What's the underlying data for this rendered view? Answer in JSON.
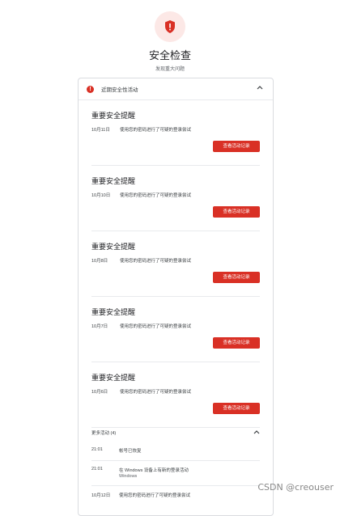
{
  "header": {
    "title": "安全检查",
    "subtitle": "发现重大问题"
  },
  "card": {
    "section_label": "近期安全性活动",
    "alerts": [
      {
        "title": "重要安全提醒",
        "date": "10月11日",
        "description": "使用您的密码进行了可疑的登录尝试",
        "button": "查看活动记录"
      },
      {
        "title": "重要安全提醒",
        "date": "10月10日",
        "description": "使用您的密码进行了可疑的登录尝试",
        "button": "查看活动记录"
      },
      {
        "title": "重要安全提醒",
        "date": "10月8日",
        "description": "使用您的密码进行了可疑的登录尝试",
        "button": "查看活动记录"
      },
      {
        "title": "重要安全提醒",
        "date": "10月7日",
        "description": "使用您的密码进行了可疑的登录尝试",
        "button": "查看活动记录"
      },
      {
        "title": "重要安全提醒",
        "date": "10月6日",
        "description": "使用您的密码进行了可疑的登录尝试",
        "button": "查看活动记录"
      }
    ],
    "more": {
      "label": "更多活动 (4)",
      "items": [
        {
          "time": "21:01",
          "description": "帐号已恢复",
          "sub": ""
        },
        {
          "time": "21:01",
          "description": "在 Windows 设备上有新的登录活动",
          "sub": "Windows"
        },
        {
          "time": "10月12日",
          "description": "使用您的密码进行了可疑的登录尝试",
          "sub": ""
        }
      ]
    }
  },
  "watermark": "CSDN @creouser",
  "colors": {
    "accent": "#d93025",
    "accent_light": "#fce8e6"
  }
}
